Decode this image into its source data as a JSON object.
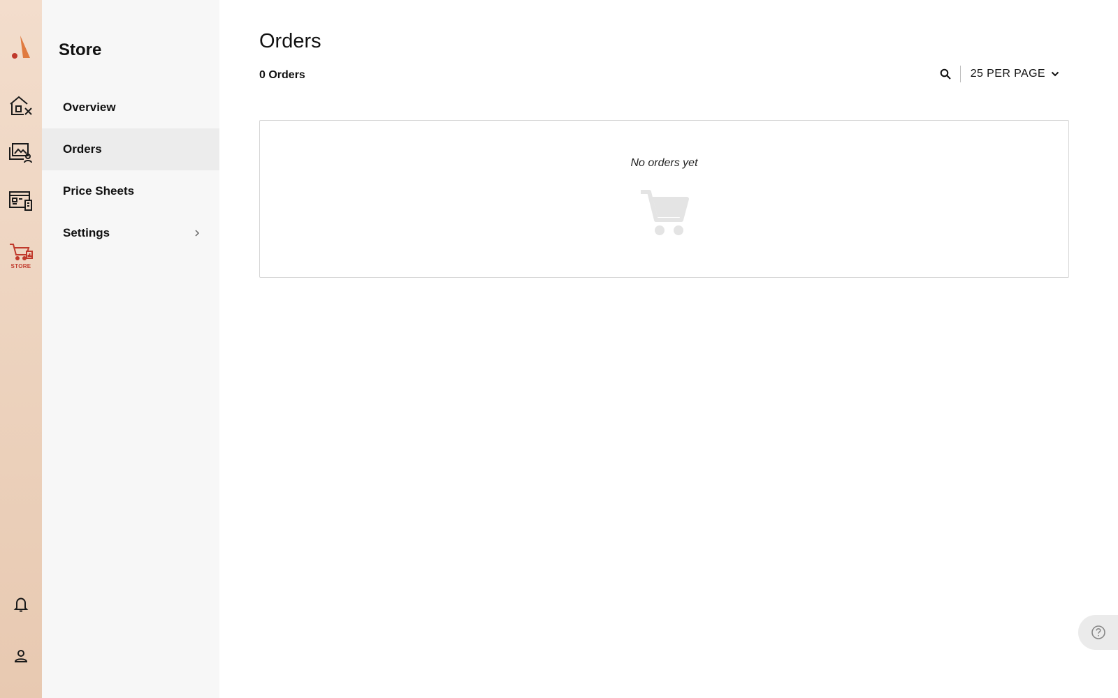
{
  "rail": {
    "logo_icon": "brand-logo-icon",
    "items": [
      {
        "name": "property-tools-icon"
      },
      {
        "name": "gallery-clients-icon"
      },
      {
        "name": "website-builder-icon"
      },
      {
        "name": "store-cart-icon",
        "caption": "STORE",
        "active": true
      }
    ],
    "bottom": [
      {
        "name": "bell-icon"
      },
      {
        "name": "user-icon"
      }
    ]
  },
  "sidenav": {
    "title": "Store",
    "items": [
      {
        "label": "Overview"
      },
      {
        "label": "Orders",
        "active": true
      },
      {
        "label": "Price Sheets"
      },
      {
        "label": "Settings",
        "has_submenu": true
      }
    ]
  },
  "main": {
    "title": "Orders",
    "count_label": "0 Orders",
    "per_page_label": "25 PER PAGE",
    "empty_text": "No orders yet",
    "empty_icon": "cart-icon"
  },
  "help": {
    "icon": "question-circle-icon"
  },
  "colors": {
    "accent": "#c0392b",
    "logo": "#e07a3f",
    "rail_bg": "#f0d9c6",
    "sidenav_bg": "#f7f7f7",
    "active_item_bg": "#ececec",
    "empty_icon": "#e4e4e4"
  }
}
